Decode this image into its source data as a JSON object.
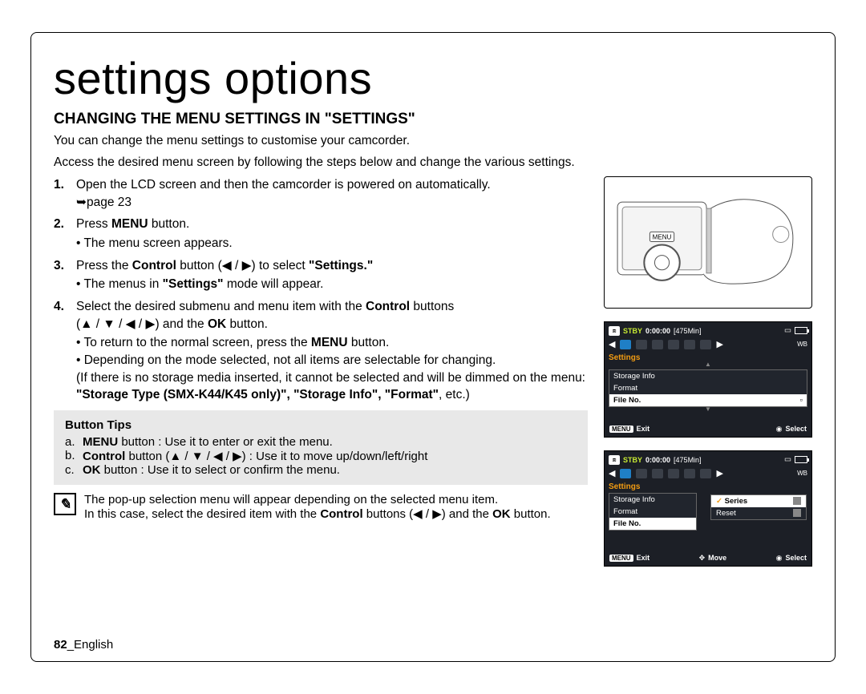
{
  "page_title": "settings options",
  "section_title": "CHANGING THE MENU SETTINGS IN \"SETTINGS\"",
  "intro_line1": "You can change the menu settings to customise your camcorder.",
  "intro_line2": "Access the desired menu screen by following the steps below and change the various settings.",
  "steps": {
    "s1_a": "Open the LCD screen and then the camcorder is powered on automatically.",
    "s1_b": "➥page 23",
    "s2_a_pre": "Press ",
    "s2_a_bold": "MENU",
    "s2_a_post": " button.",
    "s2_sub": "The menu screen appears.",
    "s3_a_pre": "Press the ",
    "s3_a_bold1": "Control",
    "s3_a_mid": " button (◀ / ▶) to select ",
    "s3_a_bold2": "\"Settings.\"",
    "s3_sub_pre": "The menus in ",
    "s3_sub_bold": "\"Settings\"",
    "s3_sub_post": " mode will appear.",
    "s4_a_pre": "Select the desired submenu and menu item with the ",
    "s4_a_bold": "Control",
    "s4_a_post": " buttons",
    "s4_line2_pre": "(▲ / ▼ / ◀ / ▶) and the ",
    "s4_line2_bold": "OK",
    "s4_line2_post": " button.",
    "s4_sub1_pre": "To return to the normal screen, press the ",
    "s4_sub1_bold": "MENU",
    "s4_sub1_post": " button.",
    "s4_sub2": "Depending on the mode selected, not all items are selectable for changing.",
    "s4_sub3_pre": "(If there is no storage media inserted, it cannot be selected and will be dimmed on the menu: ",
    "s4_sub3_bold": "\"Storage Type (SMX-K44/K45 only)\", \"Storage Info\", \"Format\"",
    "s4_sub3_post": ", etc.)"
  },
  "button_tips": {
    "heading": "Button Tips",
    "a_pre": "",
    "a_bold": "MENU",
    "a_post": " button : Use it to enter or exit the menu.",
    "b_pre": "",
    "b_bold": "Control",
    "b_post": " button (▲ / ▼ / ◀ / ▶) : Use it to move up/down/left/right",
    "c_pre": "",
    "c_bold": "OK",
    "c_post": " button : Use it to select or confirm the menu."
  },
  "note": {
    "line1": "The pop-up selection menu will appear depending on the selected menu item.",
    "line2_pre": "In this case, select the desired item with the ",
    "line2_bold1": "Control",
    "line2_mid": " buttons (◀ / ▶) and the ",
    "line2_bold2": "OK",
    "line2_post": " button."
  },
  "camcorder": {
    "menu_label": "MENU"
  },
  "lcd1": {
    "stby": "STBY",
    "time": "0:00:00",
    "remain": "[475Min]",
    "settings_label": "Settings",
    "items": [
      "Storage Info",
      "Format",
      "File No."
    ],
    "highlight_index": 2,
    "exit": "Exit",
    "menu": "MENU",
    "select": "Select"
  },
  "lcd2": {
    "stby": "STBY",
    "time": "0:00:00",
    "remain": "[475Min]",
    "settings_label": "Settings",
    "left_items": [
      "Storage Info",
      "Format",
      "File No."
    ],
    "submenu": {
      "items": [
        "Series",
        "Reset"
      ],
      "highlight_index": 0
    },
    "exit": "Exit",
    "menu": "MENU",
    "move": "Move",
    "select": "Select"
  },
  "footer": {
    "page_no": "82",
    "lang": "_English"
  }
}
